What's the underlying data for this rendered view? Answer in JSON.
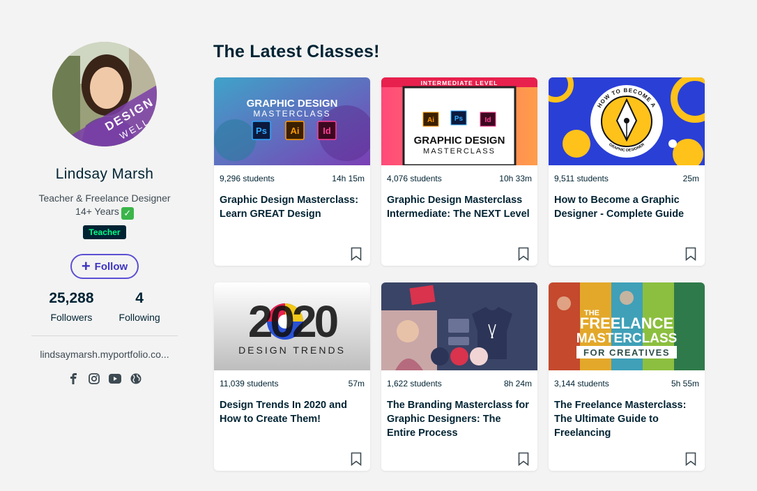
{
  "profile": {
    "name": "Lindsay Marsh",
    "avatar_text_top": "DESIGN",
    "avatar_text_bottom": "WELL",
    "tagline_line1": "Teacher & Freelance Designer",
    "tagline_line2": "14+ Years",
    "badge": "Teacher",
    "follow_label": "Follow",
    "followers_count": "25,288",
    "followers_label": "Followers",
    "following_count": "4",
    "following_label": "Following",
    "portfolio_link": "lindsaymarsh.myportfolio.co...",
    "socials": [
      "facebook-icon",
      "instagram-icon",
      "youtube-icon",
      "globe-icon"
    ]
  },
  "section_title": "The Latest Classes!",
  "classes": [
    {
      "students": "9,296 students",
      "duration": "14h 15m",
      "title": "Graphic Design Masterclass: Learn GREAT Design",
      "thumb_line1": "GRAPHIC DESIGN",
      "thumb_line2": "MASTERCLASS",
      "icons": [
        "Ps",
        "Ai",
        "Id"
      ]
    },
    {
      "students": "4,076 students",
      "duration": "10h 33m",
      "title": "Graphic Design Masterclass Intermediate: The NEXT Level",
      "thumb_banner": "INTERMEDIATE LEVEL",
      "thumb_line1": "GRAPHIC DESIGN",
      "thumb_line2": "MASTERCLASS",
      "icons": [
        "Ai",
        "Ps",
        "Id"
      ]
    },
    {
      "students": "9,511 students",
      "duration": "25m",
      "title": "How to Become a Graphic Designer - Complete Guide",
      "thumb_ring_top": "HOW TO BECOME A",
      "thumb_ring_bottom": "GRAPHIC DESIGNER"
    },
    {
      "students": "11,039 students",
      "duration": "57m",
      "title": "Design Trends In 2020 and How to Create Them!",
      "thumb_year": "2020",
      "thumb_caption": "DESIGN TRENDS"
    },
    {
      "students": "1,622 students",
      "duration": "8h 24m",
      "title": "The Branding Masterclass for Graphic Designers: The Entire Process"
    },
    {
      "students": "3,144 students",
      "duration": "5h 55m",
      "title": "The Freelance Masterclass: The Ultimate Guide to Freelancing",
      "thumb_line0": "THE",
      "thumb_line1": "FREELANCE",
      "thumb_line2": "MASTERCLASS",
      "thumb_line3": "FOR CREATIVES"
    }
  ],
  "colors": {
    "background": "#f3f3f3",
    "text_dark": "#002333",
    "follow_accent": "#5b4fd4",
    "badge_bg": "#002333",
    "badge_text": "#00ff84"
  }
}
